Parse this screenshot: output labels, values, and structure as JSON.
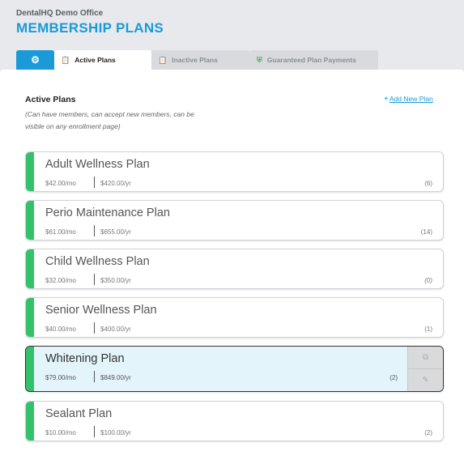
{
  "header": {
    "office": "DentalHQ Demo Office",
    "title": "MEMBERSHIP PLANS"
  },
  "tabs": [
    {
      "label": "",
      "icon": "gear-icon"
    },
    {
      "label": "Active Plans",
      "icon": "clipboard-icon"
    },
    {
      "label": "Inactive Plans",
      "icon": "clipboard-icon"
    },
    {
      "label": "Guaranteed Plan Payments",
      "icon": "shield-check-icon"
    }
  ],
  "section": {
    "title": "Active Plans",
    "description": "(Can have members, can accept new members, can be visible on any enrollment page)",
    "add_label": "Add New Plan"
  },
  "plans": [
    {
      "name": "Adult Wellness Plan",
      "monthly": "$42.00/mo",
      "yearly": "$420.00/yr",
      "count": "(6)"
    },
    {
      "name": "Perio Maintenance Plan",
      "monthly": "$61.00/mo",
      "yearly": "$655.00/yr",
      "count": "(14)"
    },
    {
      "name": "Child Wellness Plan",
      "monthly": "$32.00/mo",
      "yearly": "$350.00/yr",
      "count": "(0)"
    },
    {
      "name": "Senior Wellness Plan",
      "monthly": "$40.00/mo",
      "yearly": "$400.00/yr",
      "count": "(1)"
    },
    {
      "name": "Whitening Plan",
      "monthly": "$79.00/mo",
      "yearly": "$849.00/yr",
      "count": "(2)"
    },
    {
      "name": "Sealant Plan",
      "monthly": "$10.00/mo",
      "yearly": "$100.00/yr",
      "count": "(2)"
    }
  ],
  "colors": {
    "accent": "#1a9ad6",
    "active_bar": "#33c26b",
    "selected_bg": "#e3f4fb"
  }
}
